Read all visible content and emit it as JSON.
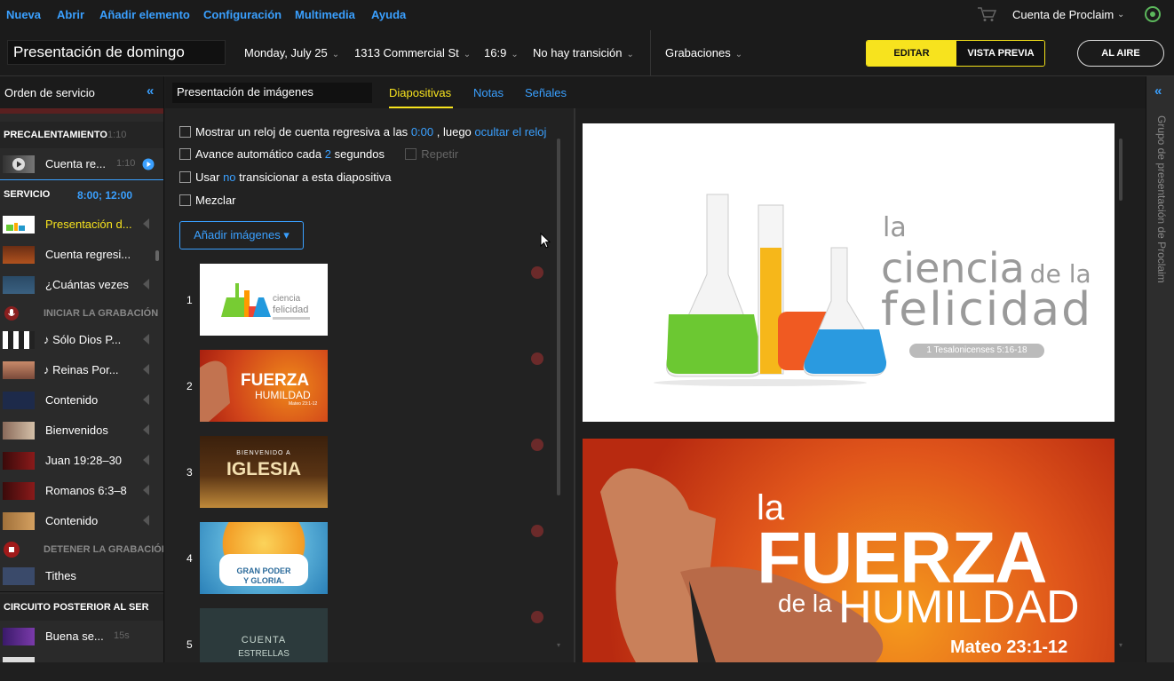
{
  "menu": [
    "Nueva",
    "Abrir",
    "Añadir elemento",
    "Configuración",
    "Multimedia",
    "Ayuda"
  ],
  "account": "Cuenta de Proclaim",
  "toolbar": {
    "title": "Presentación de domingo",
    "date": "Monday, July 25",
    "location": "1313 Commercial St",
    "aspect": "16:9",
    "transition": "No hay transición",
    "recordings": "Grabaciones",
    "edit": "EDITAR",
    "preview": "VISTA PREVIA",
    "live": "AL AIRE"
  },
  "sidebar": {
    "title": "Orden de servicio",
    "sections": {
      "pre": {
        "title": "PRECALENTAMIENTO",
        "time": "1:10"
      },
      "service": {
        "title": "SERVICIO",
        "time": "8:00; 12:00"
      },
      "post": {
        "title": "CIRCUITO POSTERIOR AL SER"
      }
    },
    "pre_item": {
      "label": "Cuenta re...",
      "time": "1:10"
    },
    "items": [
      {
        "label": "Presentación d..."
      },
      {
        "label": "Cuenta regresi..."
      },
      {
        "label": "¿Cuántas vezes"
      },
      {
        "label": "♪ Sólo Dios P..."
      },
      {
        "label": "♪ Reinas Por..."
      },
      {
        "label": "Contenido"
      },
      {
        "label": "Bienvenidos"
      },
      {
        "label": "Juan 19:28–30"
      },
      {
        "label": "Romanos 6:3–8"
      },
      {
        "label": "Contenido"
      },
      {
        "label": "Tithes"
      }
    ],
    "rec_start": "INICIAR LA GRABACIÓN",
    "rec_stop": "DETENER LA GRABACIÓI",
    "post_item": {
      "label": "Buena se...",
      "time": "15s"
    }
  },
  "middle": {
    "item_name": "Presentación de imágenes",
    "tabs": [
      "Diapositivas",
      "Notas",
      "Señales"
    ],
    "opt1": {
      "a": "Mostrar un reloj de cuenta regresiva a las",
      "time": "0:00",
      "b": ", luego",
      "link": "ocultar el reloj"
    },
    "opt2": {
      "a": "Avance automático cada",
      "num": "2",
      "b": "segundos",
      "repeat": "Repetir"
    },
    "opt3": {
      "a": "Usar",
      "no": "no",
      "b": "transicionar a esta diapositiva"
    },
    "opt4": "Mezclar",
    "add_images": "Añadir imágenes ▾",
    "slides": [
      "1",
      "2",
      "3",
      "4",
      "5"
    ]
  },
  "slide1": {
    "l1": "la",
    "l2": "ciencia",
    "l3": "de la",
    "l4": "felicidad",
    "ref": "1 Tesalonicenses 5:16-18"
  },
  "slide2": {
    "l1": "la",
    "l2": "FUERZA",
    "l3": "de la",
    "l4": "HUMILDAD",
    "ref": "Mateo 23:1-12"
  },
  "slide3": {
    "l1": "BIENVENIDO A",
    "l2": "IGLESIA"
  },
  "slide4": {
    "l1": "GRAN PODER",
    "l2": "Y GLORIA."
  },
  "slide5": {
    "l1": "CUENTA",
    "l2": "ESTRELLAS"
  },
  "rail": "Grupo de presentación de Proclaim",
  "colors": {
    "accent": "#3aa0ff",
    "yellow": "#f7e31e",
    "record": "#c0392b"
  }
}
